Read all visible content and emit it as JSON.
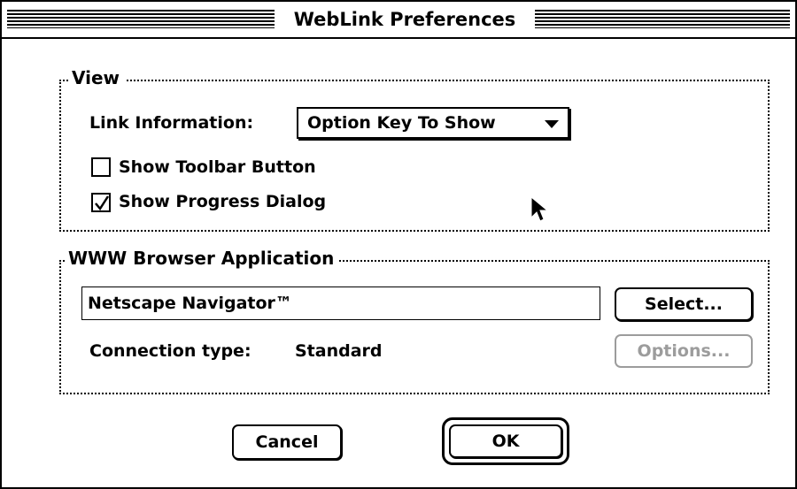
{
  "window": {
    "title": "WebLink Preferences"
  },
  "view_group": {
    "title": "View",
    "link_info_label": "Link Information:",
    "link_info_value": "Option Key To Show",
    "show_toolbar_label": "Show Toolbar Button",
    "show_toolbar_checked": false,
    "show_progress_label": "Show Progress Dialog",
    "show_progress_checked": true
  },
  "browser_group": {
    "title": "WWW Browser Application",
    "browser_name": "Netscape Navigator™",
    "select_label": "Select...",
    "connection_label": "Connection type:",
    "connection_value": "Standard",
    "options_label": "Options..."
  },
  "buttons": {
    "cancel": "Cancel",
    "ok": "OK"
  }
}
